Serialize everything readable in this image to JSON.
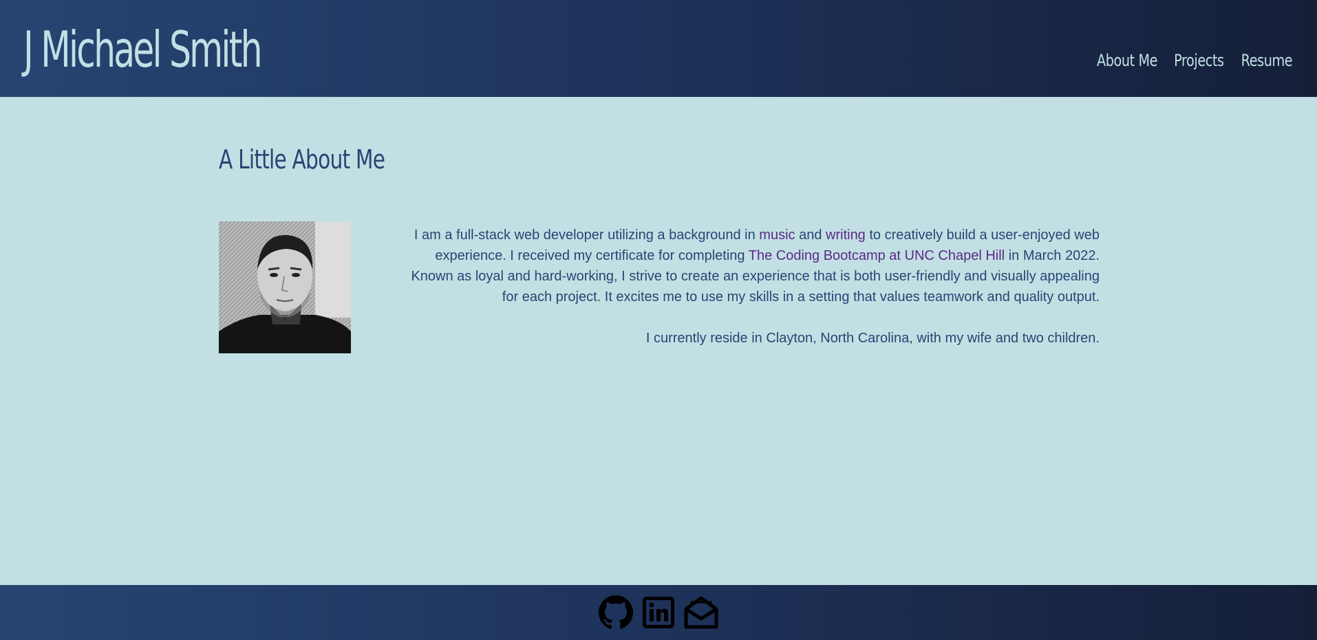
{
  "header": {
    "site_title": "J Michael Smith",
    "nav": {
      "about_label": "About Me",
      "projects_label": "Projects",
      "resume_label": "Resume"
    }
  },
  "main": {
    "section_title": "A Little About Me",
    "photo_alt": "Photo of J Michael Smith",
    "bio": {
      "p1_part1": "I am a full-stack web developer utilizing a background in ",
      "link_music": "music",
      "p1_part2": " and ",
      "link_writing": "writing",
      "p1_part3": " to creatively build a user-enjoyed web experience. I received my certificate for completing ",
      "link_bootcamp": "The Coding Bootcamp at UNC Chapel Hill",
      "p1_part4": " in March 2022. Known as loyal and hard-working, I strive to create an experience that is both user-friendly and visually appealing for each project. It excites me to use my skills in a setting that values teamwork and quality output.",
      "p2": "I currently reside in Clayton, North Carolina, with my wife and two children."
    }
  },
  "footer": {
    "icons": [
      "github-icon",
      "linkedin-icon",
      "email-icon"
    ]
  },
  "colors": {
    "background": "#c2e0e4",
    "header_gradient_start": "#264573",
    "header_gradient_end": "#151f38",
    "title_text": "#c2e0e4",
    "body_text": "#264573",
    "link_text": "#5a2a86"
  }
}
